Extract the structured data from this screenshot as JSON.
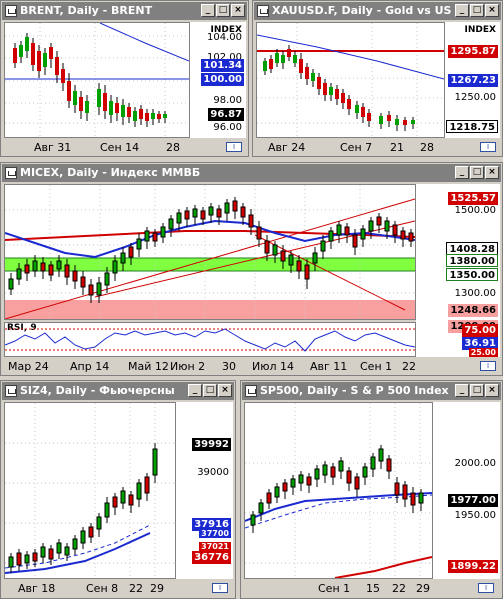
{
  "windows": {
    "brent": {
      "title": "BRENT, Daily - BRENT",
      "index_label": "INDEX",
      "ticks": [
        "104.00",
        "102.00",
        "98.00",
        "96.00"
      ],
      "price_labels": [
        "101.34",
        "100.00",
        "96.87"
      ],
      "x_labels": [
        "Авг 31",
        "Сен 14",
        "28"
      ]
    },
    "gold": {
      "title": "XAUUSD.F, Daily - Gold vs US",
      "index_label": "INDEX",
      "ticks": [
        "1250.00"
      ],
      "price_labels": [
        "1295.87",
        "1267.23",
        "1218.75"
      ],
      "x_labels": [
        "Авг 24",
        "Сен 7",
        "21",
        "28"
      ]
    },
    "micex": {
      "title": "MICEX, Daily - Индекс ММВБ",
      "ticks": [
        "1500.00",
        "1300.00"
      ],
      "price_labels": [
        "1525.57",
        "1408.28",
        "1380.00",
        "1350.00",
        "1248.66",
        "1200.00"
      ],
      "rsi_title": "RSI, 9",
      "rsi_labels": [
        "75.00",
        "36.91",
        "25.00"
      ],
      "x_labels": [
        "Мар 24",
        "Апр 14",
        "Май 12",
        "Июн 2",
        "30",
        "Июл 14",
        "Авг 11",
        "Сен 1",
        "22"
      ]
    },
    "siz4": {
      "title": "SIZ4, Daily - Фьючерсны",
      "ticks": [
        "39000"
      ],
      "price_labels": [
        "39992",
        "37916",
        "37700",
        "37021",
        "36776"
      ],
      "x_labels": [
        "Авг 18",
        "Сен 8",
        "22",
        "29"
      ]
    },
    "sp500": {
      "title": "SP500, Daily - S & P 500 Index",
      "ticks": [
        "2000.00",
        "1950.00"
      ],
      "price_labels": [
        "1977.00",
        "1899.22"
      ],
      "x_labels": [
        "Сен 1",
        "15",
        "22",
        "29"
      ]
    }
  },
  "window_buttons": {
    "minimize": "_",
    "maximize": "□",
    "close": "×"
  },
  "colors": {
    "background": "#d4d0c8",
    "title_bar": "#808080",
    "candle_up": "#00a000",
    "candle_down": "#d00000",
    "ma_blue": "#1a2ad0",
    "ma_red": "#d00000",
    "support_zone": "#80ff40",
    "resistance_zone": "#f8a0a0"
  }
}
